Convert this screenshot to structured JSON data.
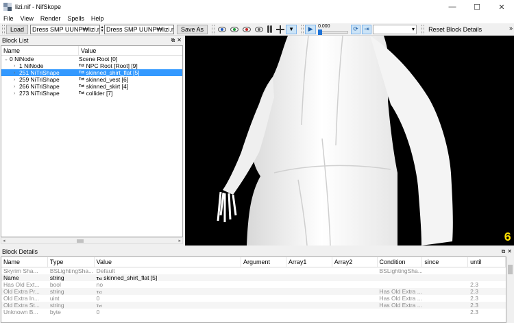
{
  "window": {
    "title": "lizi.nif - NifSkope",
    "minimize": "—",
    "maximize": "☐",
    "close": "✕"
  },
  "menu": [
    "File",
    "View",
    "Render",
    "Spells",
    "Help"
  ],
  "toolbar": {
    "load_label": "Load",
    "load_path": "Dress SMP UUNP₩lizi.nif",
    "save_path": "Dress SMP UUNP₩lizi.nif",
    "save_label": "Save As",
    "slider_value": "0.000",
    "reset_label": "Reset Block Details",
    "more": "»"
  },
  "block_list": {
    "title": "Block List",
    "columns": [
      "Name",
      "Value"
    ],
    "rows": [
      {
        "name": "0 NiNode",
        "value": "Scene Root [0]",
        "txt": false
      },
      {
        "name": "1 NiNode",
        "value": "NPC Root [Root] [9]",
        "txt": true
      },
      {
        "name": "251 NiTriShape",
        "value": "skinned_shirt_flat [5]",
        "txt": true
      },
      {
        "name": "259 NiTriShape",
        "value": "skinned_vest [6]",
        "txt": true
      },
      {
        "name": "266 NiTriShape",
        "value": "skinned_skirt [4]",
        "txt": true
      },
      {
        "name": "273 NiTriShape",
        "value": "collider [7]",
        "txt": true
      }
    ],
    "selected_index": 2
  },
  "viewport": {
    "fps": "6"
  },
  "block_details": {
    "title": "Block Details",
    "columns": [
      "Name",
      "Type",
      "Value",
      "Argument",
      "Array1",
      "Array2",
      "Condition",
      "since",
      "until"
    ],
    "rows": [
      {
        "name": "Skyrim Sha...",
        "type": "BSLightingSha...",
        "value": "Default",
        "argument": "",
        "array1": "",
        "array2": "",
        "condition": "BSLightingSha...",
        "since": "",
        "until": "",
        "dim": true,
        "txt": false
      },
      {
        "name": "Name",
        "type": "string",
        "value": "skinned_shirt_flat [5]",
        "argument": "",
        "array1": "",
        "array2": "",
        "condition": "",
        "since": "",
        "until": "",
        "dim": false,
        "txt": true
      },
      {
        "name": "Has Old Ext...",
        "type": "bool",
        "value": "no",
        "argument": "",
        "array1": "",
        "array2": "",
        "condition": "",
        "since": "",
        "until": "2.3",
        "dim": true,
        "txt": false
      },
      {
        "name": "Old Extra Pr...",
        "type": "string",
        "value": "",
        "argument": "",
        "array1": "",
        "array2": "",
        "condition": "Has Old Extra ...",
        "since": "",
        "until": "2.3",
        "dim": true,
        "txt": true
      },
      {
        "name": "Old Extra In...",
        "type": "uint",
        "value": "0",
        "argument": "",
        "array1": "",
        "array2": "",
        "condition": "Has Old Extra ...",
        "since": "",
        "until": "2.3",
        "dim": true,
        "txt": false
      },
      {
        "name": "Old Extra St...",
        "type": "string",
        "value": "",
        "argument": "",
        "array1": "",
        "array2": "",
        "condition": "Has Old Extra ...",
        "since": "",
        "until": "2.3",
        "dim": true,
        "txt": true
      },
      {
        "name": "Unknown B...",
        "type": "byte",
        "value": "0",
        "argument": "",
        "array1": "",
        "array2": "",
        "condition": "",
        "since": "",
        "until": "2.3",
        "dim": true,
        "txt": false
      }
    ]
  },
  "icons": {
    "txt": "Txt",
    "float": "⧉",
    "dock_close": "✕"
  }
}
